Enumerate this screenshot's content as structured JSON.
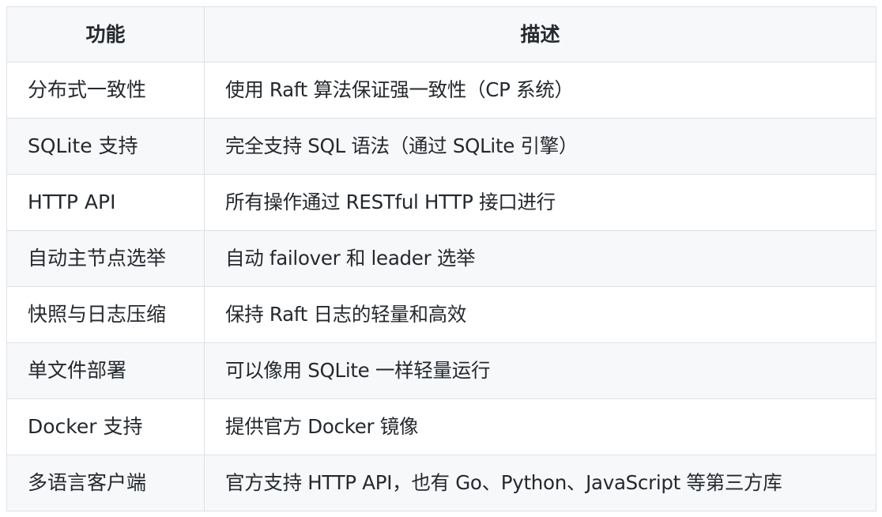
{
  "table": {
    "headers": [
      "功能",
      "描述"
    ],
    "rows": [
      {
        "feature": "分布式一致性",
        "description": "使用 Raft 算法保证强一致性（CP 系统）"
      },
      {
        "feature": "SQLite 支持",
        "description": "完全支持 SQL 语法（通过 SQLite 引擎）"
      },
      {
        "feature": "HTTP API",
        "description": "所有操作通过 RESTful HTTP 接口进行"
      },
      {
        "feature": "自动主节点选举",
        "description": "自动 failover 和 leader 选举"
      },
      {
        "feature": "快照与日志压缩",
        "description": "保持 Raft 日志的轻量和高效"
      },
      {
        "feature": "单文件部署",
        "description": "可以像用 SQLite 一样轻量运行"
      },
      {
        "feature": "Docker 支持",
        "description": "提供官方 Docker 镜像"
      },
      {
        "feature": "多语言客户端",
        "description": "官方支持 HTTP API，也有 Go、Python、JavaScript 等第三方库"
      }
    ]
  }
}
